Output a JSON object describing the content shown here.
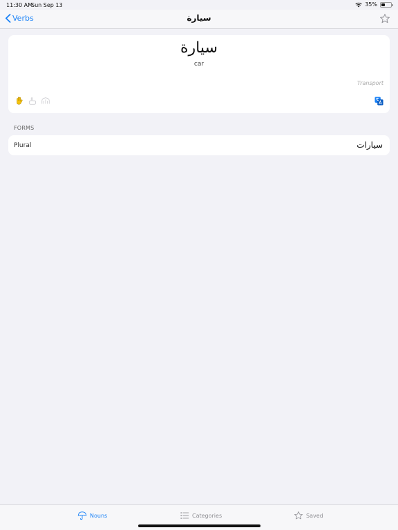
{
  "status_bar": {
    "time": "11:30 AM",
    "date": "Sun Sep 13",
    "battery": "35%",
    "battery_level": 0.35
  },
  "nav": {
    "back_label": "Verbs",
    "title": "سيارة"
  },
  "word": {
    "arabic": "سيارة",
    "english": "car",
    "category": "Transport"
  },
  "forms": {
    "header": "FORMS",
    "rows": [
      {
        "label": "Plural",
        "value": "سيارات"
      }
    ]
  },
  "tabs": [
    {
      "label": "Nouns",
      "icon": "umbrella-icon",
      "active": true
    },
    {
      "label": "Categories",
      "icon": "list-icon",
      "active": false
    },
    {
      "label": "Saved",
      "icon": "star-icon",
      "active": false
    }
  ],
  "colors": {
    "accent": "#1a82f7",
    "background": "#f2f2f7",
    "gesture_active": "#f4c20d"
  }
}
